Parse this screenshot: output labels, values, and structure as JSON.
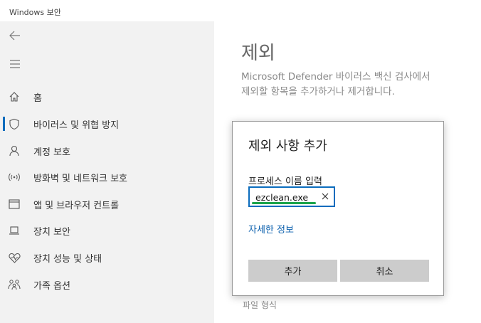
{
  "window": {
    "title": "Windows 보안"
  },
  "nav": {
    "back_icon": "back-arrow-icon",
    "menu_icon": "hamburger-icon",
    "items": [
      {
        "label": "홈",
        "icon": "home-icon"
      },
      {
        "label": "바이러스 및 위협 방지",
        "icon": "shield-icon",
        "active": true
      },
      {
        "label": "계정 보호",
        "icon": "person-icon"
      },
      {
        "label": "방화벽 및 네트워크 보호",
        "icon": "wifi-antenna-icon"
      },
      {
        "label": "앱 및 브라우저 컨트롤",
        "icon": "app-window-icon"
      },
      {
        "label": "장치 보안",
        "icon": "laptop-icon"
      },
      {
        "label": "장치 성능 및 상태",
        "icon": "heart-pulse-icon"
      },
      {
        "label": "가족 옵션",
        "icon": "family-icon"
      }
    ]
  },
  "main": {
    "title": "제외",
    "desc_line1": "Microsoft Defender 바이러스 백신 검사에서",
    "desc_line2": "제외할 항목을 추가하거나 제거합니다.",
    "bottom_text": "파일 형식"
  },
  "dialog": {
    "title": "제외 사항 추가",
    "field_label": "프로세스 이름 입력",
    "input_value": "ezclean.exe",
    "link": "자세한 정보",
    "add_label": "추가",
    "cancel_label": "취소"
  },
  "colors": {
    "accent": "#0a6cbd",
    "link": "#0a5fad",
    "sidebar_bg": "#f2f2f2",
    "button_bg": "#cccccc",
    "highlight_underline": "#1aa34a"
  }
}
